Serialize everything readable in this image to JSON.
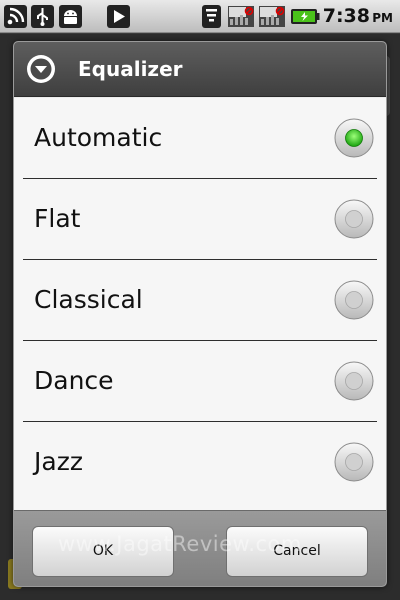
{
  "status_bar": {
    "time": "7:38",
    "ampm": "PM",
    "icons": [
      "signal-icon",
      "usb-icon",
      "android-debug-icon",
      "media-play-icon",
      "wifi-icon",
      "sim-card-1-icon",
      "sim-card-2-icon",
      "battery-charging-icon"
    ]
  },
  "dialog": {
    "title": "Equalizer",
    "header_icon": "dropdown-circle-icon",
    "options": [
      {
        "label": "Automatic",
        "selected": true
      },
      {
        "label": "Flat",
        "selected": false
      },
      {
        "label": "Classical",
        "selected": false
      },
      {
        "label": "Dance",
        "selected": false
      },
      {
        "label": "Jazz",
        "selected": false
      }
    ],
    "ok_label": "OK",
    "cancel_label": "Cancel"
  },
  "watermark": "www.JagatReview.com",
  "colors": {
    "header_bg": "#4a4a4a",
    "list_bg": "#f6f6f6",
    "radio_selected": "#2ecc1a",
    "radio_unselected": "#d6d6d6"
  }
}
